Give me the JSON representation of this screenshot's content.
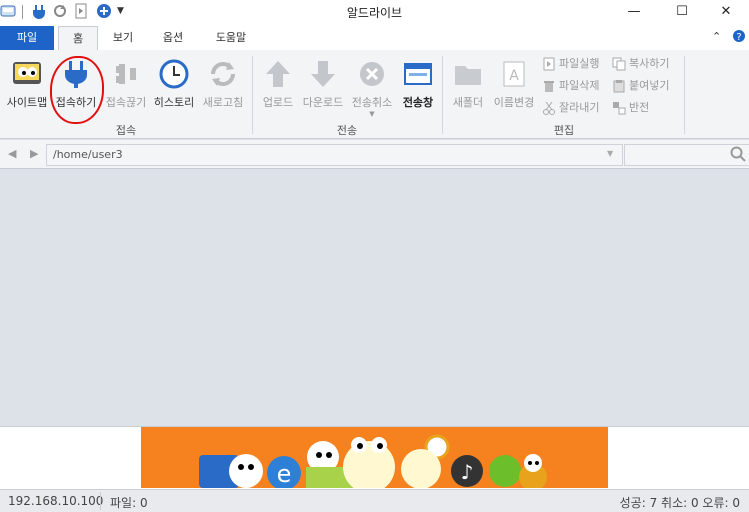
{
  "window": {
    "title": "알드라이브",
    "controls": {
      "minimize": "—",
      "maximize": "☐",
      "close": "✕"
    }
  },
  "tabs": [
    {
      "label": "파일"
    },
    {
      "label": "홈"
    },
    {
      "label": "보기"
    },
    {
      "label": "옵션"
    },
    {
      "label": "도움말"
    }
  ],
  "ribbon": {
    "groups": {
      "connect": {
        "label": "접속",
        "buttons": {
          "sitemap": "사이트맵",
          "connect": "접속하기",
          "disconnect": "접속끊기",
          "history": "히스토리",
          "refresh": "새로고침"
        }
      },
      "transfer": {
        "label": "전송",
        "buttons": {
          "upload": "업로드",
          "download": "다운로드",
          "cancel": "전송취소",
          "window": "전송창"
        }
      },
      "edit": {
        "label": "편집",
        "buttons": {
          "new_folder": "새폴더",
          "rename": "이름변경",
          "run": "파일실행",
          "copy": "복사하기",
          "delete": "파일삭제",
          "paste": "붙여넣기",
          "cut": "잘라내기",
          "invert": "반전"
        }
      }
    }
  },
  "address": {
    "path": "/home/user3"
  },
  "statusbar": {
    "ip": "192.168.10.100",
    "files": "파일: 0",
    "counts": "성공: 7 취소: 0 오류: 0"
  },
  "colors": {
    "accent": "#1e63c7",
    "banner": "#f5821f",
    "annotation": "#e01010"
  }
}
